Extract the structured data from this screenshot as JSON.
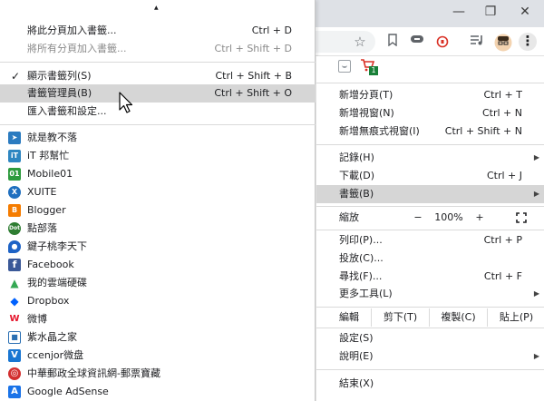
{
  "window": {
    "minimize_glyph": "—",
    "restore_glyph": "❐",
    "close_glyph": "✕"
  },
  "toolbar": {
    "star_icon": "☆",
    "bookmark_icon": "bookmark-icon",
    "menu_glyph": "⋮"
  },
  "bookmarks_submenu": {
    "scroll_up_glyph": "▲",
    "items": [
      {
        "label": "將此分頁加入書籤...",
        "shortcut": "Ctrl + D"
      },
      {
        "label": "將所有分頁加入書籤...",
        "shortcut": "Ctrl + Shift + D"
      },
      {
        "label": "顯示書籤列(S)",
        "shortcut": "Ctrl + Shift + B",
        "checked": "✓"
      },
      {
        "label": "書籤管理員(B)",
        "shortcut": "Ctrl + Shift + O"
      },
      {
        "label": "匯入書籤和設定..."
      }
    ],
    "bookmarks": [
      {
        "label": "就是教不落",
        "icon": "paper-plane-icon",
        "color": "#2b7bc0",
        "glyph": "➤"
      },
      {
        "label": "iT 邦幫忙",
        "icon": "ithelp-icon",
        "color": "#2e86c1",
        "glyph": "iT"
      },
      {
        "label": "Mobile01",
        "icon": "mobile01-icon",
        "color": "#2e9b3e",
        "glyph": "01"
      },
      {
        "label": "XUITE",
        "icon": "xuite-icon",
        "color": "#1f6fbf",
        "glyph": "X"
      },
      {
        "label": "Blogger",
        "icon": "blogger-icon",
        "color": "#f57c00",
        "glyph": "B"
      },
      {
        "label": "點部落",
        "icon": "dotblog-icon",
        "color": "#2e7d32",
        "glyph": "Dot"
      },
      {
        "label": "鍵子桃李天下",
        "icon": "chat-bubble-icon",
        "color": "#1e63c6",
        "glyph": "●"
      },
      {
        "label": "Facebook",
        "icon": "facebook-icon",
        "color": "#3b5998",
        "glyph": "f"
      },
      {
        "label": "我的雲端硬碟",
        "icon": "google-drive-icon",
        "color": "#34a853",
        "glyph": "▲"
      },
      {
        "label": "Dropbox",
        "icon": "dropbox-icon",
        "color": "#0061fe",
        "glyph": "◆"
      },
      {
        "label": "微博",
        "icon": "weibo-icon",
        "color": "#e6162d",
        "glyph": "W"
      },
      {
        "label": "紫水晶之家",
        "icon": "bookmark-folder-icon",
        "color": "#2a6fb3",
        "glyph": "■"
      },
      {
        "label": "ccenjor微盘",
        "icon": "vdisk-icon",
        "color": "#1976d2",
        "glyph": "V"
      },
      {
        "label": "中華郵政全球資訊網-郵票寶藏",
        "icon": "chunghwa-post-icon",
        "color": "#d32f2f",
        "glyph": "◎"
      },
      {
        "label": "Google AdSense",
        "icon": "adsense-icon",
        "color": "#1a73e8",
        "glyph": "A"
      }
    ]
  },
  "main_menu": {
    "items": [
      {
        "label": "新增分頁(T)",
        "shortcut": "Ctrl + T"
      },
      {
        "label": "新增視窗(N)",
        "shortcut": "Ctrl + N"
      },
      {
        "label": "新增無痕式視窗(I)",
        "shortcut": "Ctrl + Shift + N"
      },
      {
        "label": "記錄(H)"
      },
      {
        "label": "下載(D)",
        "shortcut": "Ctrl + J"
      },
      {
        "label": "書籤(B)"
      },
      {
        "label": "列印(P)...",
        "shortcut": "Ctrl + P"
      },
      {
        "label": "投放(C)..."
      },
      {
        "label": "尋找(F)...",
        "shortcut": "Ctrl + F"
      },
      {
        "label": "更多工具(L)"
      },
      {
        "label": "設定(S)"
      },
      {
        "label": "說明(E)"
      },
      {
        "label": "結束(X)"
      }
    ],
    "zoom": {
      "label": "縮放",
      "minus": "−",
      "value": "100%",
      "plus": "+",
      "fullscreen_glyph": "⛶"
    },
    "edit": {
      "label": "編輯",
      "cut": "剪下(T)",
      "copy": "複製(C)",
      "paste": "貼上(P)"
    },
    "extensions": {
      "cart_badge": "1"
    }
  }
}
